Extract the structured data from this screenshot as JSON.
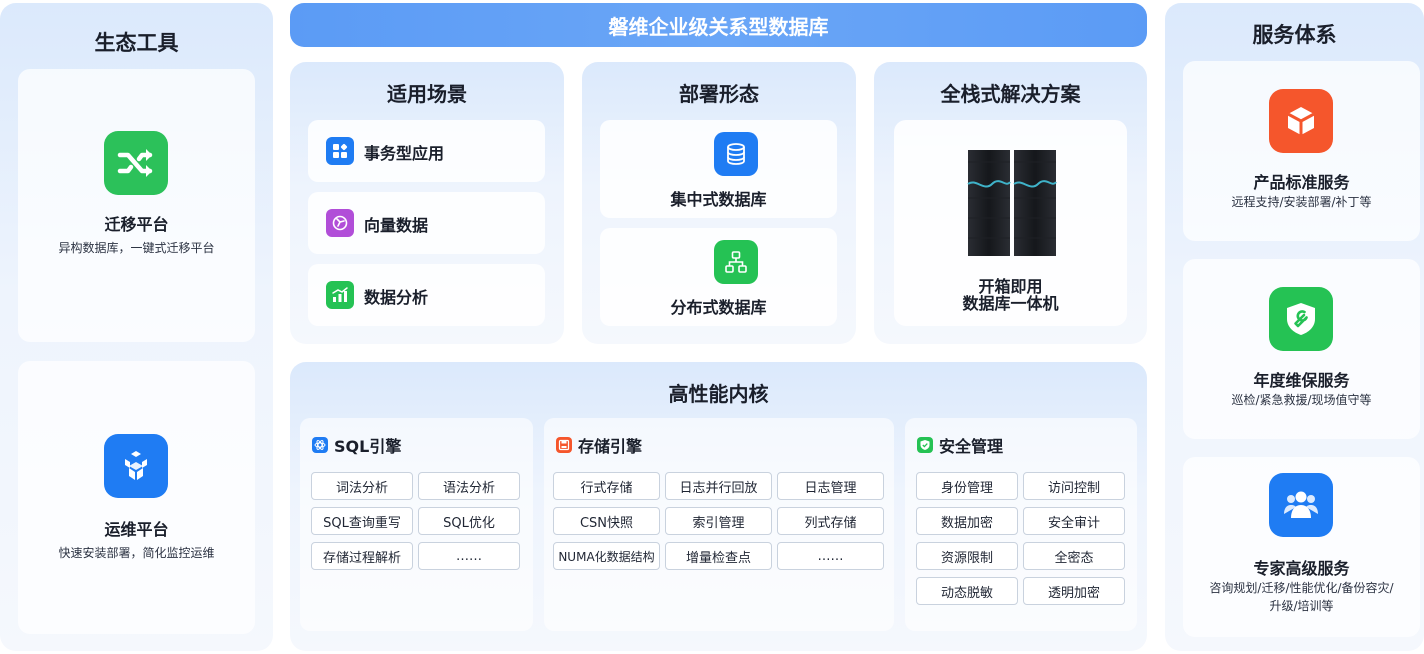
{
  "ecosystem": {
    "title": "生态工具",
    "items": [
      {
        "title": "迁移平台",
        "desc": "异构数据库，一键式迁移平台",
        "icon": "shuffle-icon"
      },
      {
        "title": "运维平台",
        "desc": "快速安装部署，简化监控运维",
        "icon": "cubes-icon"
      }
    ]
  },
  "banner": {
    "title": "磐维企业级关系型数据库"
  },
  "scenarios": {
    "title": "适用场景",
    "items": [
      {
        "label": "事务型应用",
        "icon": "grid-icon"
      },
      {
        "label": "向量数据",
        "icon": "vector-icon"
      },
      {
        "label": "数据分析",
        "icon": "bar-chart-icon"
      }
    ]
  },
  "deployment": {
    "title": "部署形态",
    "items": [
      {
        "label": "集中式数据库",
        "icon": "database-icon"
      },
      {
        "label": "分布式数据库",
        "icon": "distributed-icon"
      }
    ]
  },
  "fullstack": {
    "title": "全栈式解决方案",
    "line1": "开箱即用",
    "line2": "数据库一体机"
  },
  "kernel": {
    "title": "高性能内核",
    "sql": {
      "title": "SQL引擎",
      "chips": [
        "词法分析",
        "语法分析",
        "SQL查询重写",
        "SQL优化",
        "存储过程解析",
        "……"
      ]
    },
    "storage": {
      "title": "存储引擎",
      "chips": [
        "行式存储",
        "日志并行回放",
        "日志管理",
        "CSN快照",
        "索引管理",
        "列式存储",
        "NUMA化数据结构",
        "增量检查点",
        "……"
      ]
    },
    "security": {
      "title": "安全管理",
      "chips": [
        "身份管理",
        "访问控制",
        "数据加密",
        "安全审计",
        "资源限制",
        "全密态",
        "动态脱敏",
        "透明加密"
      ]
    }
  },
  "services": {
    "title": "服务体系",
    "items": [
      {
        "title": "产品标准服务",
        "desc": "远程支持/安装部署/补丁等",
        "icon": "cube-icon"
      },
      {
        "title": "年度维保服务",
        "desc": "巡检/紧急救援/现场值守等",
        "icon": "wrench-shield-icon"
      },
      {
        "title": "专家高级服务",
        "desc": "咨询规划/迁移/性能优化/备份容灾/",
        "desc2": "升级/培训等",
        "icon": "people-icon"
      }
    ]
  },
  "colors": {
    "green": "#25c254",
    "blue": "#1f7cf3",
    "orange": "#f5562c",
    "purple": "#b14ed8"
  }
}
